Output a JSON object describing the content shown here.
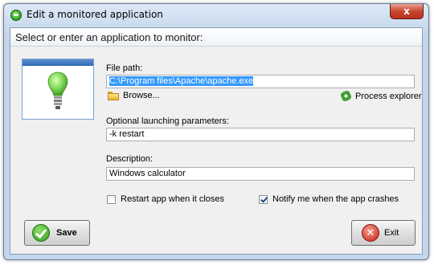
{
  "window": {
    "title": "Edit a monitored application",
    "close_glyph": "x"
  },
  "heading": "Select or enter an application to monitor:",
  "file_path": {
    "label": "File path:",
    "value": "C:\\Program files\\Apache\\apache.exe"
  },
  "browse_label": "Browse...",
  "process_explorer_label": "Process explorer",
  "launch_params": {
    "label": "Optional launching parameters:",
    "value": "-k restart"
  },
  "description": {
    "label": "Description:",
    "value": "Windows calculator"
  },
  "checkboxes": {
    "restart_label": "Restart app when it closes",
    "restart_checked": false,
    "notify_label": "Notify me when the app crashes",
    "notify_checked": true
  },
  "buttons": {
    "save_label": "Save",
    "exit_label": "Exit"
  },
  "icons": {
    "app": "app-status-icon",
    "bulb": "lightbulb-icon",
    "folder": "folder-icon",
    "process": "gear-icon",
    "save": "checkmark-icon",
    "exit": "close-circle-icon"
  },
  "colors": {
    "selection": "#3399ff",
    "bulb_green": "#7ed957",
    "panel_blue": "#2f68b4"
  }
}
